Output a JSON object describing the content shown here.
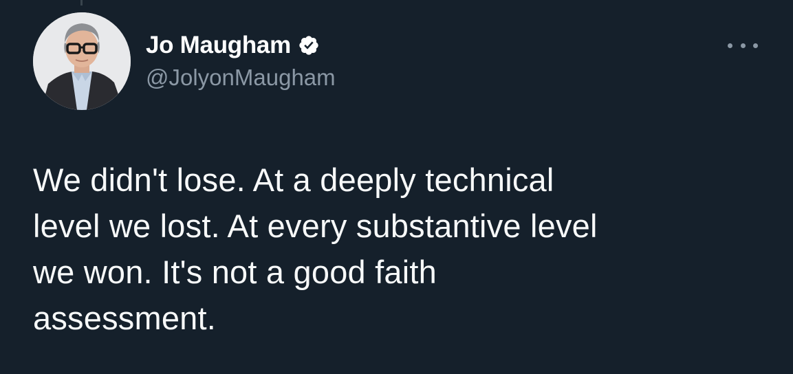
{
  "theme": {
    "background": "#15202b",
    "text_primary": "#ffffff",
    "text_secondary": "#8b98a5",
    "verified_badge": "#ffffff"
  },
  "author": {
    "display_name": "Jo Maugham",
    "handle": "@JolyonMaugham",
    "verified": true,
    "verified_icon": "verified-badge-icon",
    "avatar_icon": "profile-photo"
  },
  "actions": {
    "more_icon": "more-horizontal-icon"
  },
  "tweet": {
    "lines": [
      "We didn't lose. At a deeply technical",
      "level we lost. At every substantive level",
      "we won. It's not a good faith",
      "assessment."
    ]
  }
}
